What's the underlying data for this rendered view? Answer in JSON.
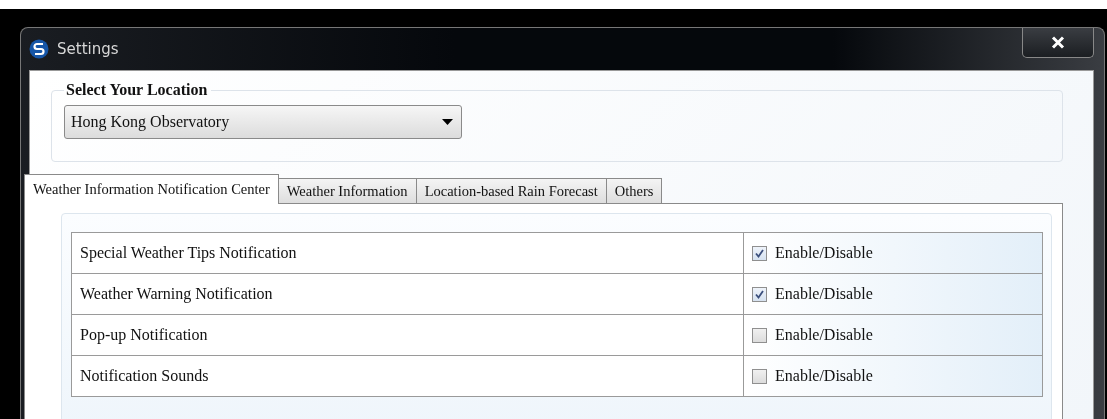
{
  "window": {
    "title": "Settings"
  },
  "location": {
    "legend": "Select Your Location",
    "value": "Hong Kong Observatory"
  },
  "tabs": [
    {
      "label": "Weather Information Notification Center",
      "selected": true
    },
    {
      "label": "Weather Information",
      "selected": false
    },
    {
      "label": "Location-based Rain Forecast",
      "selected": false
    },
    {
      "label": "Others",
      "selected": false
    }
  ],
  "settings": [
    {
      "name": "Special Weather Tips Notification",
      "checked": true,
      "option": "Enable/Disable"
    },
    {
      "name": "Weather Warning Notification",
      "checked": true,
      "option": "Enable/Disable"
    },
    {
      "name": "Pop-up Notification",
      "checked": false,
      "option": "Enable/Disable"
    },
    {
      "name": "Notification Sounds",
      "checked": false,
      "option": "Enable/Disable"
    }
  ]
}
